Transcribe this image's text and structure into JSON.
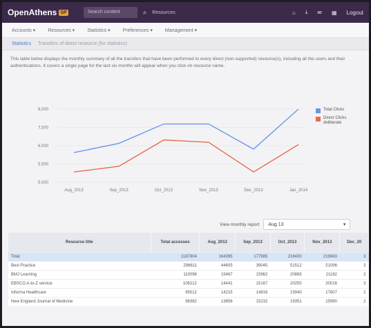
{
  "app": {
    "logo_text": "OpenAthens",
    "logo_badge": "SP",
    "search_placeholder": "Search content",
    "search_icon": "search-icon",
    "search_scope": "Resources",
    "top_actions": [
      {
        "icon": "home-icon",
        "glyph": "⌂"
      },
      {
        "icon": "download-icon",
        "glyph": "⤓"
      },
      {
        "icon": "chat-icon",
        "glyph": "✉"
      },
      {
        "icon": "grid-icon",
        "glyph": "▦"
      }
    ],
    "logout_label": "Logout",
    "accent": "#3b2a4a"
  },
  "menu": {
    "items": [
      "Accounts ▾",
      "Resources ▾",
      "Statistics ▾",
      "Preferences ▾",
      "Management ▾"
    ]
  },
  "breadcrumb": {
    "link": "Statistics",
    "current": "Transfers of direct resource (for statistics)"
  },
  "description": {
    "text": "This table below displays the monthly summary of all the transfers that have been performed to every direct (non-supported) resource(s), including all the users and their authentications. It covers a single page for the last six months will appear when you click on resource name."
  },
  "chart_data": {
    "type": "line",
    "categories": [
      "Aug_2013",
      "Sep_2013",
      "Oct_2013",
      "Nov_2013",
      "Dec_2013",
      "Jan_2014"
    ],
    "series": [
      {
        "name": "Total Clicks",
        "color": "#6a96e6",
        "values": [
          6300,
          6700,
          7550,
          7550,
          6450,
          8200
        ]
      },
      {
        "name": "Direct Clicks deliberate",
        "color": "#ea6a4a",
        "values": [
          5450,
          5700,
          6850,
          6750,
          5450,
          6650
        ]
      }
    ],
    "yticks": [
      "5,000",
      "5,500",
      "6,000",
      "7,500",
      "8,000"
    ],
    "ylim": [
      5000,
      8200
    ],
    "legend_position": "top-right"
  },
  "report": {
    "label": "View monthly report",
    "selected": "Aug 13",
    "chevron_icon": "chevron-down-icon"
  },
  "table": {
    "headers": [
      "Resource title",
      "Total accesses",
      "Aug_2013",
      "Sep_2013",
      "Oct_2013",
      "Nov_2013",
      "Dec_20"
    ],
    "total": [
      "Total",
      "1187904",
      "164395",
      "177985",
      "218430",
      "219843",
      "3"
    ],
    "rows": [
      [
        "Best Practice",
        "296611",
        "44605",
        "39045",
        "51512",
        "51096",
        "3"
      ],
      [
        "BMJ Learning",
        "110096",
        "15467",
        "15962",
        "20865",
        "21182",
        "2"
      ],
      [
        "EBSCO A-to-Z service",
        "106212",
        "14441",
        "15167",
        "20250",
        "20016",
        "3"
      ],
      [
        "Informa Healthcare",
        "95512",
        "14215",
        "14816",
        "15940",
        "17807",
        "2"
      ],
      [
        "New England Journal of Medicine",
        "98382",
        "13856",
        "15232",
        "19351",
        "15990",
        "2"
      ]
    ]
  }
}
